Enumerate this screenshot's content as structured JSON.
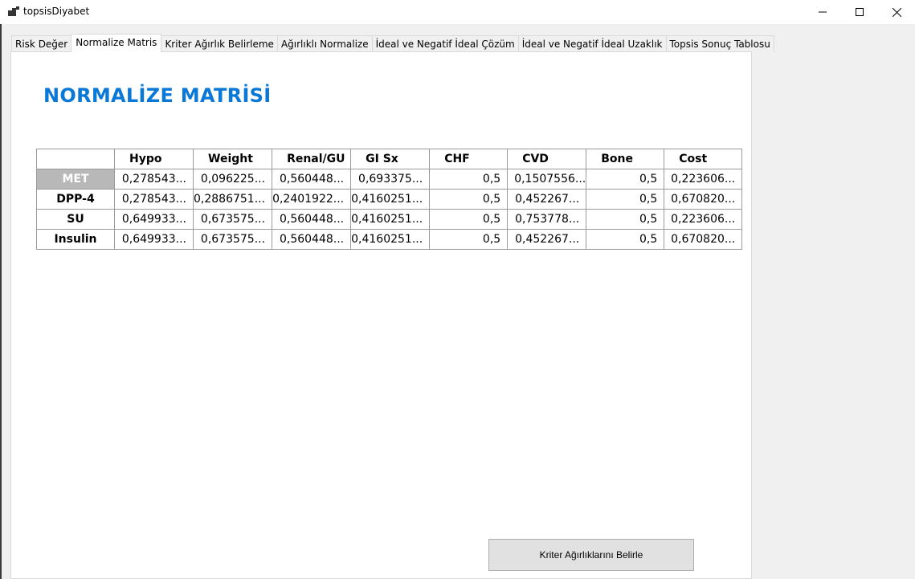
{
  "window": {
    "title": "topsisDiyabet",
    "minimize_glyph": "—",
    "maximize_glyph": "☐",
    "close_glyph": "✕",
    "icon": "app-icon"
  },
  "tabs": [
    {
      "label": "Risk Değer",
      "active": false
    },
    {
      "label": "Normalize Matris",
      "active": true
    },
    {
      "label": "Kriter Ağırlık Belirleme",
      "active": false
    },
    {
      "label": "Ağırlıklı Normalize",
      "active": false
    },
    {
      "label": "İdeal ve Negatif İdeal Çözüm",
      "active": false
    },
    {
      "label": "İdeal ve Negatif İdeal Uzaklık",
      "active": false
    },
    {
      "label": "Topsis Sonuç Tablosu",
      "active": false
    }
  ],
  "page": {
    "heading": "NORMALİZE MATRİSİ",
    "heading_color": "#0a78d7"
  },
  "grid": {
    "columns": [
      "Hypo",
      "Weight",
      "Renal/GU",
      "GI Sx",
      "CHF",
      "CVD",
      "Bone",
      "Cost"
    ],
    "rows": [
      {
        "label": "MET",
        "selected": true,
        "cells": [
          "0,278543...",
          "0,096225...",
          "0,560448...",
          "0,693375...",
          "0,5",
          "0,1507556...",
          "0,5",
          "0,223606..."
        ]
      },
      {
        "label": "DPP-4",
        "selected": false,
        "cells": [
          "0,278543...",
          "0,2886751...",
          "0,2401922...",
          "0,4160251...",
          "0,5",
          "0,452267...",
          "0,5",
          "0,670820..."
        ]
      },
      {
        "label": "SU",
        "selected": false,
        "cells": [
          "0,649933...",
          "0,673575...",
          "0,560448...",
          "0,4160251...",
          "0,5",
          "0,753778...",
          "0,5",
          "0,223606..."
        ]
      },
      {
        "label": "Insulin",
        "selected": false,
        "cells": [
          "0,649933...",
          "0,673575...",
          "0,560448...",
          "0,4160251...",
          "0,5",
          "0,452267...",
          "0,5",
          "0,670820..."
        ]
      }
    ]
  },
  "button": {
    "label": "Kriter Ağırlıklarını Belirle"
  }
}
